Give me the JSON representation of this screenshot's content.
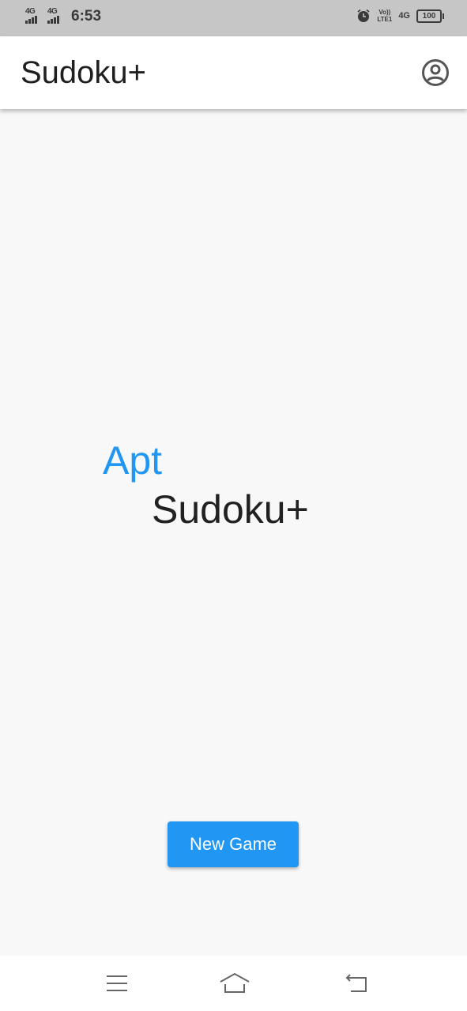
{
  "status_bar": {
    "network_1": "4G",
    "network_2": "4G",
    "time": "6:53",
    "volte_line1": "Vo))",
    "volte_line2": "LTE1",
    "network_3": "4G",
    "battery": "100"
  },
  "app_bar": {
    "title": "Sudoku+",
    "account_icon": "account-circle-icon"
  },
  "main": {
    "logo_line1": "Apt",
    "logo_line2": "Sudoku+",
    "new_game_label": "New Game"
  },
  "nav_bar": {
    "menu_icon": "menu-icon",
    "home_icon": "home-icon",
    "back_icon": "back-icon"
  },
  "colors": {
    "accent": "#2196f3",
    "background": "#f8f8f8",
    "status_bar": "#c6c6c6",
    "text_primary": "#212121"
  }
}
